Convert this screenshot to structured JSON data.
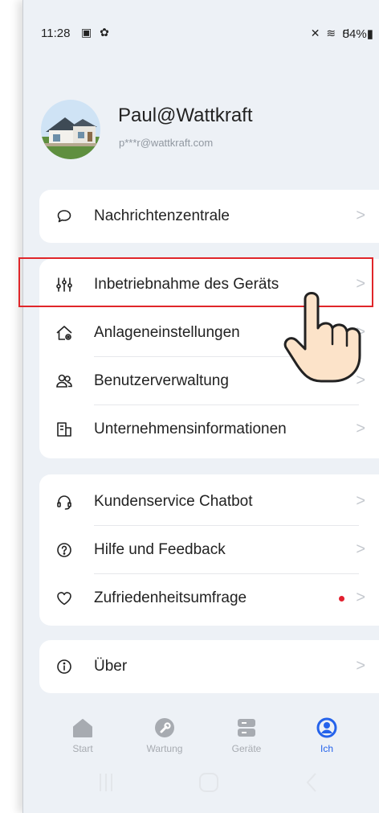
{
  "status_bar": {
    "time": "11:28",
    "left_icons": "▣ ✿",
    "right_icons": "✕ ≋ ıl",
    "battery": "54%"
  },
  "profile": {
    "name": "Paul@Wattkraft",
    "email": "p***r@wattkraft.com"
  },
  "menu": {
    "group1": [
      {
        "label": "Nachrichtenzentrale",
        "icon": "message-icon"
      }
    ],
    "group2": [
      {
        "label": "Inbetriebnahme des Geräts",
        "icon": "sliders-icon"
      },
      {
        "label": "Anlageneinstellungen",
        "icon": "home-settings-icon"
      },
      {
        "label": "Benutzerverwaltung",
        "icon": "users-icon"
      },
      {
        "label": "Unternehmensinformationen",
        "icon": "building-icon"
      }
    ],
    "group3": [
      {
        "label": "Kundenservice Chatbot",
        "icon": "headset-icon"
      },
      {
        "label": "Hilfe und Feedback",
        "icon": "help-icon"
      },
      {
        "label": "Zufriedenheitsumfrage",
        "icon": "heart-icon"
      }
    ],
    "group4": [
      {
        "label": "Über",
        "icon": "info-icon"
      }
    ],
    "chevron": ">"
  },
  "tabs": [
    {
      "label": "Start",
      "icon": "home-icon"
    },
    {
      "label": "Wartung",
      "icon": "wrench-icon"
    },
    {
      "label": "Geräte",
      "icon": "devices-icon"
    },
    {
      "label": "Ich",
      "icon": "user-icon",
      "active": true
    }
  ],
  "colors": {
    "accent": "#2563eb",
    "highlight": "#e0262a",
    "badge": "#e2202f",
    "background": "#edf1f6"
  }
}
